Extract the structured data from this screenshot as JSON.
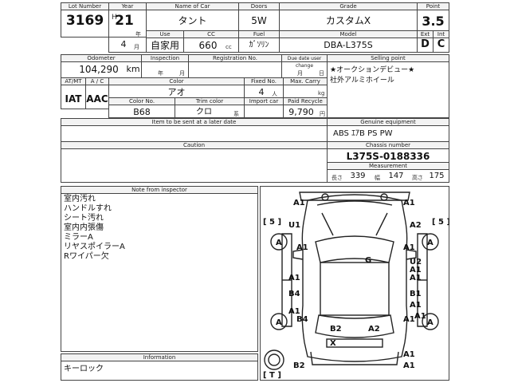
{
  "top": {
    "lot_number_label": "Lot Number",
    "lot_number": "3169",
    "year_label": "Year",
    "year_era": "H",
    "year": "21",
    "year_suffix": "年",
    "month": "4",
    "month_suffix": "月",
    "name_label": "Name of Car",
    "name": "タント",
    "doors_label": "Doors",
    "doors": "5W",
    "grade_label": "Grade",
    "grade": "カスタムX",
    "point_label": "Point",
    "point": "3.5",
    "use_label": "Use",
    "use": "自家用",
    "cc_label": "CC",
    "cc": "660",
    "cc_unit": "cc",
    "fuel_label": "Fuel",
    "fuel": "ｶﾞｿﾘﾝ",
    "model_label": "Model",
    "model": "DBA-L375S",
    "ext_label": "Ext",
    "int_label": "Int",
    "ext": "D",
    "int": "C"
  },
  "mid": {
    "odometer_label": "Odometer",
    "odometer": "104,290",
    "odometer_unit": "km",
    "inspection_label": "Inspection",
    "inspection_year": "年",
    "inspection_month": "月",
    "registration_label": "Registration No.",
    "due_date_label": "Due date user change",
    "due_month": "月",
    "due_day": "日",
    "selling_point_label": "Selling point",
    "selling_points": [
      "★オークションデビュー★",
      "社外アルミホイール"
    ],
    "at_label": "AT/MT",
    "ac_label": "A / C",
    "at": "IAT",
    "ac": "AAC",
    "color_label": "Color",
    "color": "アオ",
    "fixed_no_label": "Fixed No.",
    "fixed_no": "4",
    "fixed_no_unit": "人",
    "max_carry_label": "Max. Carry",
    "max_carry_unit": "kg",
    "color_no_label": "Color No.",
    "color_no": "B68",
    "trim_color_label": "Trim color",
    "trim_color": "クロ",
    "trim_color_unit": "系",
    "import_car_label": "Import car",
    "paid_recycle_label": "Paid Recycle",
    "paid_recycle": "9,790",
    "paid_recycle_unit": "円",
    "item_sent_label": "Item to be sent at a later date",
    "genuine_label": "Genuine equipment",
    "genuine": "ABS ｴｱB PS PW",
    "caution_label": "Caution",
    "chassis_label": "Chassis number",
    "chassis": "L375S-0188336",
    "measurement_label": "Measurement",
    "length_label": "長さ",
    "length": "339",
    "width_label": "幅",
    "width": "147",
    "height_label": "高さ",
    "height": "175"
  },
  "bottom": {
    "note_label": "Note from inspector",
    "notes": [
      "室内汚れ",
      "ハンドルすれ",
      "シート汚れ",
      "室内内張傷",
      "ミラーA",
      "リヤスポイラーA",
      "Rワイパー欠"
    ],
    "information_label": "Information",
    "information": "キーロック"
  },
  "map": {
    "labels": [
      "A1",
      "A1",
      "[ 5 ]",
      "[ 5 ]",
      "U1",
      "A2",
      "A",
      "A",
      "A1",
      "A1",
      "U2",
      "G",
      "A1",
      "A1",
      "A1",
      "B4",
      "B1",
      "A1",
      "A1",
      "A1",
      "B4",
      "A",
      "A",
      "A1",
      "B2",
      "A2",
      "X",
      "A1",
      "B2",
      "[ T ]",
      "A1"
    ]
  }
}
